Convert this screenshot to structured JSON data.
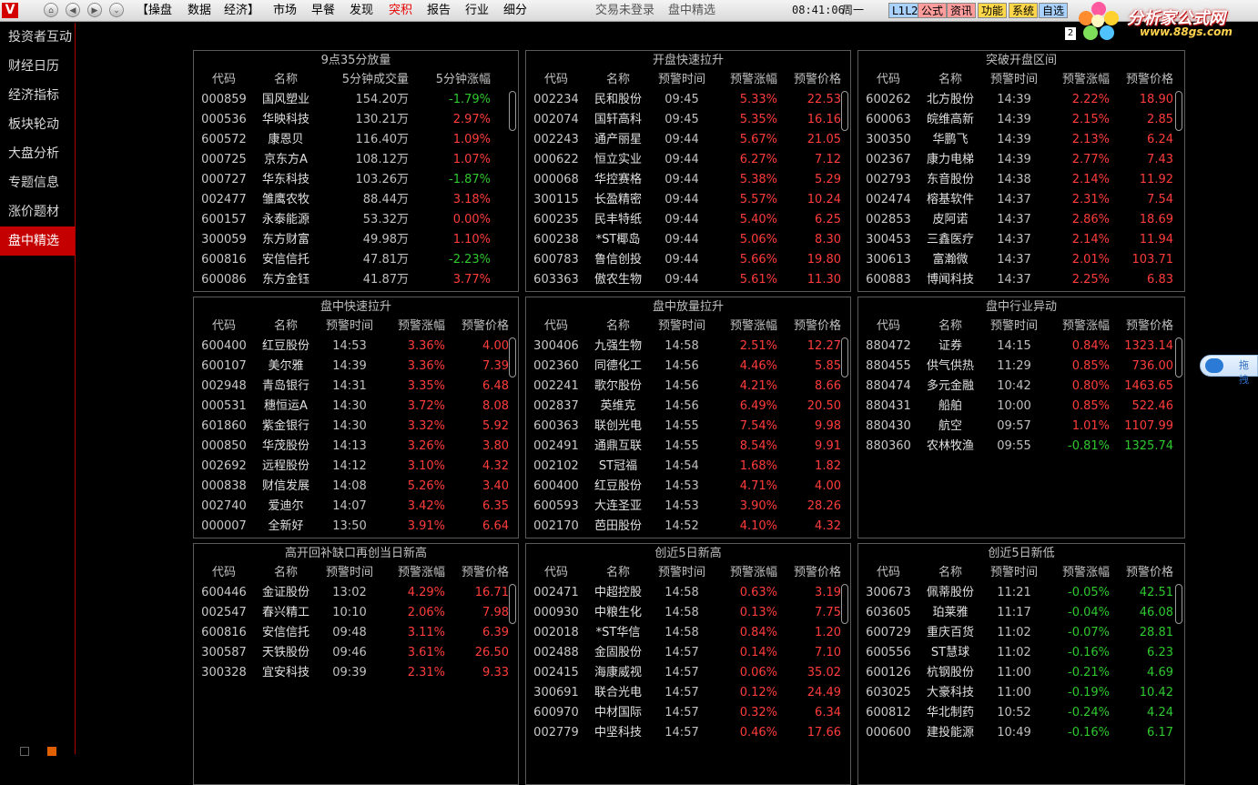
{
  "topbar": {
    "menu": [
      {
        "label": "【操盘",
        "active": false
      },
      {
        "label": "数据",
        "active": false
      },
      {
        "label": "经济】",
        "active": false
      },
      {
        "label": "市场",
        "active": false
      },
      {
        "label": "早餐",
        "active": false
      },
      {
        "label": "发现",
        "active": false
      },
      {
        "label": "突积",
        "active": true
      },
      {
        "label": "报告",
        "active": false
      },
      {
        "label": "行业",
        "active": false
      },
      {
        "label": "细分",
        "active": false
      }
    ],
    "login_status": "交易未登录",
    "page_name": "盘中精选",
    "time": "08:41:06",
    "weekday": "周一",
    "buttons": [
      {
        "label": "L1L2",
        "bg": "#a9d2ff"
      },
      {
        "label": "公式",
        "bg": "#ff9c9c"
      },
      {
        "label": "资讯",
        "bg": "#ff9c9c"
      },
      {
        "label": "功能",
        "bg": "#ffd84a"
      },
      {
        "label": "系统",
        "bg": "#ffd84a"
      },
      {
        "label": "自选",
        "bg": "#a9d2ff"
      }
    ],
    "watermark_title": "分析家公式网",
    "watermark_url": "www.88gs.com",
    "small_box": "2"
  },
  "sidebar": {
    "items": [
      {
        "label": "投资者互动",
        "active": false
      },
      {
        "label": "财经日历",
        "active": false
      },
      {
        "label": "经济指标",
        "active": false
      },
      {
        "label": "板块轮动",
        "active": false
      },
      {
        "label": "大盘分析",
        "active": false
      },
      {
        "label": "专题信息",
        "active": false
      },
      {
        "label": "涨价题材",
        "active": false
      },
      {
        "label": "盘中精选",
        "active": true
      }
    ]
  },
  "float_button": {
    "label": "拖拽"
  },
  "panels": [
    {
      "title": "9点35分放量",
      "wide": true,
      "headers": [
        "代码",
        "名称",
        "5分钟成交量",
        "5分钟涨幅"
      ],
      "rows": [
        [
          "000859",
          "国风塑业",
          "154.20万",
          "-1.79%"
        ],
        [
          "000536",
          "华映科技",
          "130.21万",
          "2.97%"
        ],
        [
          "600572",
          "康恩贝",
          "116.40万",
          "1.09%"
        ],
        [
          "000725",
          "京东方A",
          "108.12万",
          "1.07%"
        ],
        [
          "000727",
          "华东科技",
          "103.26万",
          "-1.87%"
        ],
        [
          "002477",
          "雏鹰农牧",
          "88.44万",
          "3.18%"
        ],
        [
          "600157",
          "永泰能源",
          "53.32万",
          "0.00%"
        ],
        [
          "300059",
          "东方财富",
          "49.98万",
          "1.10%"
        ],
        [
          "600816",
          "安信信托",
          "47.81万",
          "-2.23%"
        ],
        [
          "600086",
          "东方金钰",
          "41.87万",
          "3.77%"
        ]
      ]
    },
    {
      "title": "开盘快速拉升",
      "wide": false,
      "headers": [
        "代码",
        "名称",
        "预警时间",
        "预警涨幅",
        "预警价格"
      ],
      "rows": [
        [
          "002234",
          "民和股份",
          "09:45",
          "5.33%",
          "22.53"
        ],
        [
          "002074",
          "国轩高科",
          "09:45",
          "5.35%",
          "16.16"
        ],
        [
          "002243",
          "通产丽星",
          "09:44",
          "5.67%",
          "21.05"
        ],
        [
          "000622",
          "恒立实业",
          "09:44",
          "6.27%",
          "7.12"
        ],
        [
          "000068",
          "华控赛格",
          "09:44",
          "5.38%",
          "5.29"
        ],
        [
          "300115",
          "长盈精密",
          "09:44",
          "5.57%",
          "10.24"
        ],
        [
          "600235",
          "民丰特纸",
          "09:44",
          "5.40%",
          "6.25"
        ],
        [
          "600238",
          "*ST椰岛",
          "09:44",
          "5.06%",
          "8.30"
        ],
        [
          "600783",
          "鲁信创投",
          "09:44",
          "5.66%",
          "19.80"
        ],
        [
          "603363",
          "傲农生物",
          "09:44",
          "5.61%",
          "11.30"
        ]
      ]
    },
    {
      "title": "突破开盘区间",
      "wide": false,
      "headers": [
        "代码",
        "名称",
        "预警时间",
        "预警涨幅",
        "预警价格"
      ],
      "rows": [
        [
          "600262",
          "北方股份",
          "14:39",
          "2.22%",
          "18.90"
        ],
        [
          "600063",
          "皖维高新",
          "14:39",
          "2.15%",
          "2.85"
        ],
        [
          "300350",
          "华鹏飞",
          "14:39",
          "2.13%",
          "6.24"
        ],
        [
          "002367",
          "康力电梯",
          "14:39",
          "2.77%",
          "7.43"
        ],
        [
          "002793",
          "东音股份",
          "14:38",
          "2.14%",
          "11.92"
        ],
        [
          "002474",
          "榕基软件",
          "14:37",
          "2.31%",
          "7.54"
        ],
        [
          "002853",
          "皮阿诺",
          "14:37",
          "2.86%",
          "18.69"
        ],
        [
          "300453",
          "三鑫医疗",
          "14:37",
          "2.14%",
          "11.94"
        ],
        [
          "300613",
          "富瀚微",
          "14:37",
          "2.01%",
          "103.71"
        ],
        [
          "600883",
          "博闻科技",
          "14:37",
          "2.25%",
          "6.83"
        ]
      ]
    },
    {
      "title": "盘中快速拉升",
      "wide": false,
      "headers": [
        "代码",
        "名称",
        "预警时间",
        "预警涨幅",
        "预警价格"
      ],
      "rows": [
        [
          "600400",
          "红豆股份",
          "14:53",
          "3.36%",
          "4.00"
        ],
        [
          "600107",
          "美尔雅",
          "14:39",
          "3.36%",
          "7.39"
        ],
        [
          "002948",
          "青岛银行",
          "14:31",
          "3.35%",
          "6.48"
        ],
        [
          "000531",
          "穗恒运A",
          "14:30",
          "3.72%",
          "8.08"
        ],
        [
          "601860",
          "紫金银行",
          "14:30",
          "3.32%",
          "5.92"
        ],
        [
          "000850",
          "华茂股份",
          "14:13",
          "3.26%",
          "3.80"
        ],
        [
          "002692",
          "远程股份",
          "14:12",
          "3.10%",
          "4.32"
        ],
        [
          "000838",
          "财信发展",
          "14:08",
          "5.26%",
          "3.40"
        ],
        [
          "002740",
          "爱迪尔",
          "14:07",
          "3.42%",
          "6.35"
        ],
        [
          "000007",
          "全新好",
          "13:50",
          "3.91%",
          "6.64"
        ]
      ]
    },
    {
      "title": "盘中放量拉升",
      "wide": false,
      "headers": [
        "代码",
        "名称",
        "预警时间",
        "预警涨幅",
        "预警价格"
      ],
      "rows": [
        [
          "300406",
          "九强生物",
          "14:58",
          "2.51%",
          "12.27"
        ],
        [
          "002360",
          "同德化工",
          "14:56",
          "4.46%",
          "5.85"
        ],
        [
          "002241",
          "歌尔股份",
          "14:56",
          "4.21%",
          "8.66"
        ],
        [
          "002837",
          "英维克",
          "14:56",
          "6.49%",
          "20.50"
        ],
        [
          "600363",
          "联创光电",
          "14:55",
          "7.54%",
          "9.98"
        ],
        [
          "002491",
          "通鼎互联",
          "14:55",
          "8.54%",
          "9.91"
        ],
        [
          "002102",
          "ST冠福",
          "14:54",
          "1.68%",
          "1.82"
        ],
        [
          "600400",
          "红豆股份",
          "14:53",
          "4.71%",
          "4.00"
        ],
        [
          "600593",
          "大连圣亚",
          "14:53",
          "3.90%",
          "28.26"
        ],
        [
          "002170",
          "芭田股份",
          "14:52",
          "4.10%",
          "4.32"
        ]
      ]
    },
    {
      "title": "盘中行业异动",
      "wide": false,
      "headers": [
        "代码",
        "名称",
        "预警时间",
        "预警涨幅",
        "预警价格"
      ],
      "rows": [
        [
          "880472",
          "证券",
          "14:15",
          "0.84%",
          "1323.14"
        ],
        [
          "880455",
          "供气供热",
          "11:29",
          "0.85%",
          "736.00"
        ],
        [
          "880474",
          "多元金融",
          "10:42",
          "0.80%",
          "1463.65"
        ],
        [
          "880431",
          "船舶",
          "10:00",
          "0.85%",
          "522.46"
        ],
        [
          "880430",
          "航空",
          "09:57",
          "1.01%",
          "1107.99"
        ],
        [
          "880360",
          "农林牧渔",
          "09:55",
          "-0.81%",
          "1325.74"
        ]
      ]
    },
    {
      "title": "高开回补缺口再创当日新高",
      "wide": false,
      "headers": [
        "代码",
        "名称",
        "预警时间",
        "预警涨幅",
        "预警价格"
      ],
      "rows": [
        [
          "600446",
          "金证股份",
          "13:02",
          "4.29%",
          "16.71"
        ],
        [
          "002547",
          "春兴精工",
          "10:10",
          "2.06%",
          "7.98"
        ],
        [
          "600816",
          "安信信托",
          "09:48",
          "3.11%",
          "6.39"
        ],
        [
          "300587",
          "天铁股份",
          "09:46",
          "3.61%",
          "26.50"
        ],
        [
          "300328",
          "宜安科技",
          "09:39",
          "2.31%",
          "9.33"
        ]
      ]
    },
    {
      "title": "创近5日新高",
      "wide": false,
      "headers": [
        "代码",
        "名称",
        "预警时间",
        "预警涨幅",
        "预警价格"
      ],
      "rows": [
        [
          "002471",
          "中超控股",
          "14:58",
          "0.63%",
          "3.19"
        ],
        [
          "000930",
          "中粮生化",
          "14:58",
          "0.13%",
          "7.75"
        ],
        [
          "002018",
          "*ST华信",
          "14:58",
          "0.84%",
          "1.20"
        ],
        [
          "002488",
          "金固股份",
          "14:57",
          "0.14%",
          "7.10"
        ],
        [
          "002415",
          "海康威视",
          "14:57",
          "0.06%",
          "35.02"
        ],
        [
          "300691",
          "联合光电",
          "14:57",
          "0.12%",
          "24.49"
        ],
        [
          "600970",
          "中材国际",
          "14:57",
          "0.32%",
          "6.34"
        ],
        [
          "002779",
          "中坚科技",
          "14:57",
          "0.46%",
          "17.66"
        ]
      ]
    },
    {
      "title": "创近5日新低",
      "wide": false,
      "headers": [
        "代码",
        "名称",
        "预警时间",
        "预警涨幅",
        "预警价格"
      ],
      "rows": [
        [
          "300673",
          "佩蒂股份",
          "11:21",
          "-0.05%",
          "42.51"
        ],
        [
          "603605",
          "珀莱雅",
          "11:17",
          "-0.04%",
          "46.08"
        ],
        [
          "600729",
          "重庆百货",
          "11:02",
          "-0.07%",
          "28.81"
        ],
        [
          "600556",
          "ST慧球",
          "11:02",
          "-0.16%",
          "6.23"
        ],
        [
          "600126",
          "杭钢股份",
          "11:00",
          "-0.21%",
          "4.69"
        ],
        [
          "603025",
          "大豪科技",
          "11:00",
          "-0.19%",
          "10.42"
        ],
        [
          "600812",
          "华北制药",
          "10:52",
          "-0.24%",
          "4.24"
        ],
        [
          "000600",
          "建投能源",
          "10:49",
          "-0.16%",
          "6.17"
        ]
      ]
    }
  ]
}
